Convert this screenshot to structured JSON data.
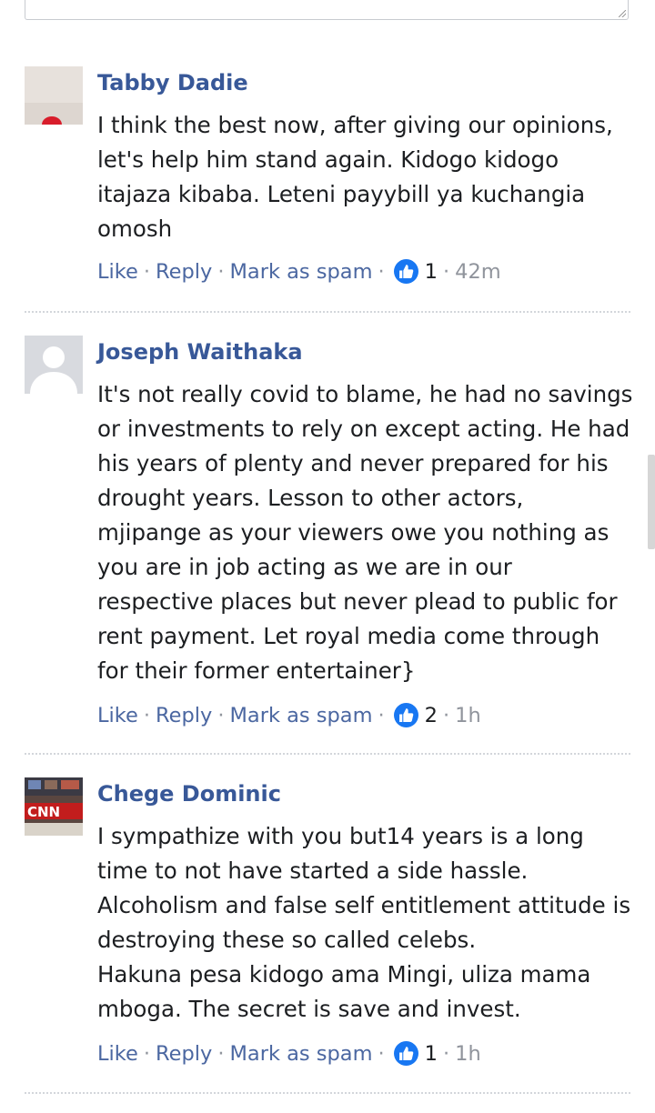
{
  "comments": [
    {
      "author": "Tabby Dadie",
      "text": "I think the best now, after giving our opinions, let's help him stand again. Kidogo kidogo itajaza kibaba. Leteni payybill ya kuchangia omosh",
      "actions": {
        "like": "Like",
        "reply": "Reply",
        "spam": "Mark as spam"
      },
      "likes": "1",
      "time": "42m",
      "avatar_icon": "avatar-photo-icon"
    },
    {
      "author": "Joseph Waithaka",
      "text": "It's not really covid to blame, he had no savings or investments to rely on except acting. He had his years of plenty and never prepared for his drought years. Lesson to other actors, mjipange as your viewers owe you nothing as you are in job acting as we are in our respective places but never plead to public for rent payment. Let royal media come through for their former entertainer}",
      "actions": {
        "like": "Like",
        "reply": "Reply",
        "spam": "Mark as spam"
      },
      "likes": "2",
      "time": "1h",
      "avatar_icon": "default-avatar-icon"
    },
    {
      "author": "Chege Dominic",
      "text": "I sympathize with you but14 years is a long time to not have started a side hassle.\nAlcoholism and false self entitlement attitude is destroying these so called celebs.\nHakuna pesa kidogo ama Mingi, uliza mama mboga. The secret is save and invest.",
      "actions": {
        "like": "Like",
        "reply": "Reply",
        "spam": "Mark as spam"
      },
      "likes": "1",
      "time": "1h",
      "avatar_icon": "cnn-avatar-icon"
    }
  ],
  "colors": {
    "author": "#385898",
    "link": "#4b67a1",
    "meta": "#90949c",
    "like_badge": "#1877f2"
  }
}
